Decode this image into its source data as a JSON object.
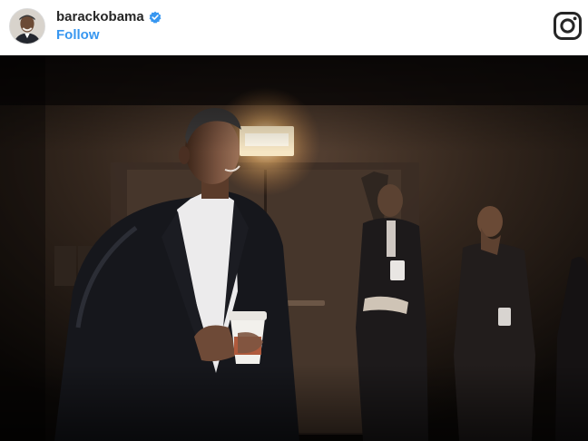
{
  "post": {
    "username": "barackobama",
    "follow_label": "Follow",
    "verified": true
  },
  "icons": {
    "verified": "verified-badge-icon",
    "logo": "instagram-logo-icon"
  },
  "colors": {
    "follow": "#3897f0",
    "verified": "#3897f0",
    "username": "#262626"
  }
}
